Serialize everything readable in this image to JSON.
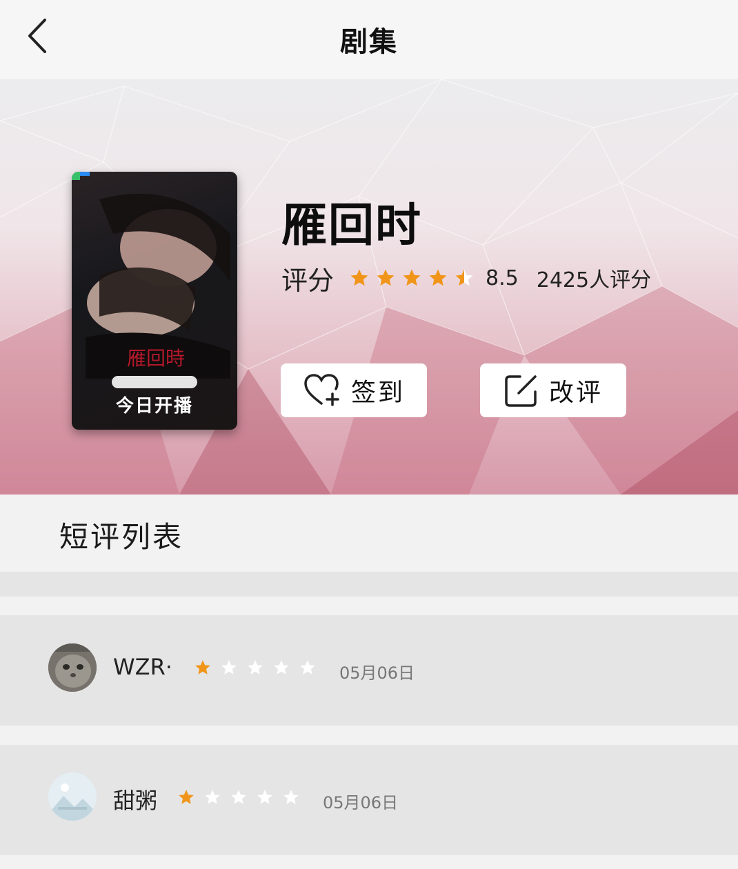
{
  "header": {
    "title": "剧集",
    "back_icon": "chevron-left-icon"
  },
  "show": {
    "title": "雁回时",
    "poster_banner": "今日开播",
    "rating_label": "评分",
    "rating_stars": 4.5,
    "score": "8.5",
    "rating_count": "2425人评分",
    "star_color": "#f0951a"
  },
  "actions": {
    "checkin_label": "签到",
    "checkin_icon": "heart-plus-icon",
    "review_label": "改评",
    "review_icon": "edit-icon"
  },
  "section": {
    "title": "短评列表"
  },
  "reviews": [
    {
      "name": "WZR·",
      "stars": 1,
      "date": "05月06日",
      "avatar": "cat-avatar"
    },
    {
      "name": "甜粥",
      "stars": 1,
      "date": "05月06日",
      "avatar": "landscape-avatar"
    }
  ]
}
